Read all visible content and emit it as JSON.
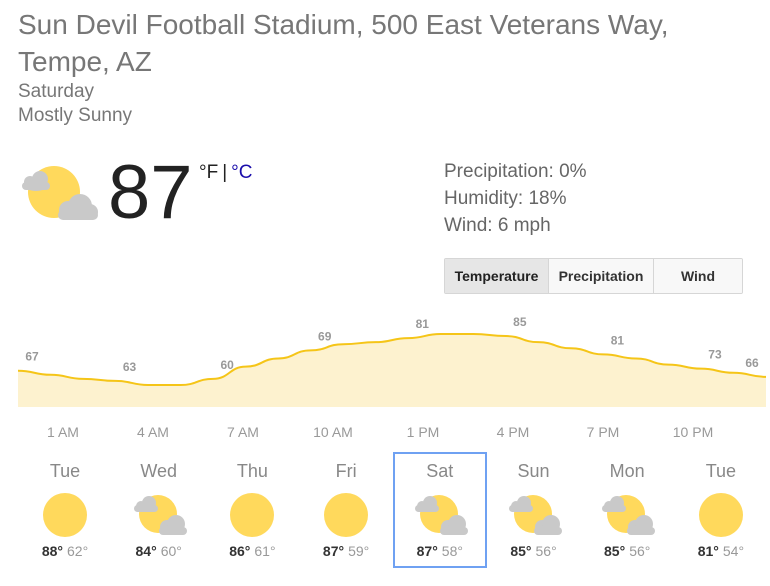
{
  "location": "Sun Devil Football Stadium, 500 East Veterans Way, Tempe, AZ",
  "day": "Saturday",
  "condition": "Mostly Sunny",
  "current": {
    "temp": "87",
    "unit_f": "°F",
    "separator": "|",
    "unit_c": "°C",
    "icon": "sun-cloud-icon"
  },
  "details": {
    "precipitation": "Precipitation: 0%",
    "humidity": "Humidity: 18%",
    "wind": "Wind: 6 mph"
  },
  "tabs": [
    {
      "label": "Temperature",
      "active": true
    },
    {
      "label": "Precipitation",
      "active": false
    },
    {
      "label": "Wind",
      "active": false
    }
  ],
  "colors": {
    "line": "#f5c518",
    "fill": "#fdf2cf",
    "sun": "#ffd95c",
    "cloud": "#c9c9c9",
    "selected_border": "#6fa1f2",
    "link": "#1a0dab"
  },
  "chart_data": {
    "type": "area",
    "series": [
      {
        "values": [
          67,
          63,
          60,
          69,
          81,
          85,
          81,
          73,
          66
        ]
      }
    ],
    "time_labels": [
      "1 AM",
      "4 AM",
      "7 AM",
      "10 AM",
      "1 PM",
      "4 PM",
      "7 PM",
      "10 PM"
    ],
    "curve_values": [
      67,
      65,
      63,
      62,
      60,
      60,
      63,
      69,
      73,
      77,
      80,
      81,
      83,
      85,
      85,
      84,
      81,
      78,
      75,
      73,
      70,
      68,
      66,
      64
    ],
    "unit": "°F"
  },
  "forecast": [
    {
      "day": "Tue",
      "hi": "88°",
      "lo": "62°",
      "icon": "sun-icon",
      "selected": false
    },
    {
      "day": "Wed",
      "hi": "84°",
      "lo": "60°",
      "icon": "sun-cloud-icon",
      "selected": false
    },
    {
      "day": "Thu",
      "hi": "86°",
      "lo": "61°",
      "icon": "sun-icon",
      "selected": false
    },
    {
      "day": "Fri",
      "hi": "87°",
      "lo": "59°",
      "icon": "sun-icon",
      "selected": false
    },
    {
      "day": "Sat",
      "hi": "87°",
      "lo": "58°",
      "icon": "sun-cloud-icon",
      "selected": true
    },
    {
      "day": "Sun",
      "hi": "85°",
      "lo": "56°",
      "icon": "sun-cloud-icon",
      "selected": false
    },
    {
      "day": "Mon",
      "hi": "85°",
      "lo": "56°",
      "icon": "sun-cloud-icon",
      "selected": false
    },
    {
      "day": "Tue",
      "hi": "81°",
      "lo": "54°",
      "icon": "sun-icon",
      "selected": false
    }
  ]
}
